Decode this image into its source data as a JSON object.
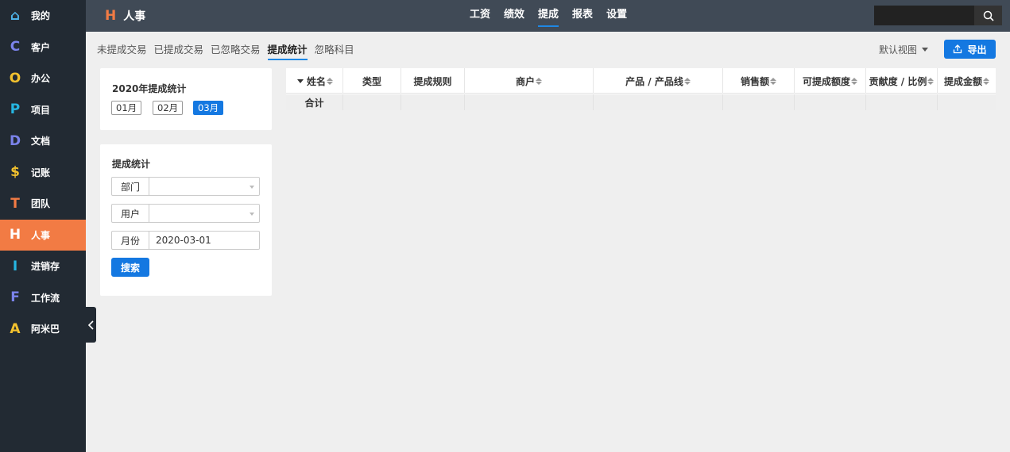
{
  "colors": {
    "sidebar_bg": "#222a33",
    "header_bg": "#404a56",
    "accent": "#f27b44",
    "primary": "#1478e1"
  },
  "sidebar": {
    "items": [
      {
        "letter": "⌂",
        "label": "我的",
        "color": "#4fb3e8",
        "icon": "home-icon"
      },
      {
        "letter": "C",
        "label": "客户",
        "color": "#7b83eb"
      },
      {
        "letter": "O",
        "label": "办公",
        "color": "#f2c12e"
      },
      {
        "letter": "P",
        "label": "项目",
        "color": "#26b6e2"
      },
      {
        "letter": "D",
        "label": "文档",
        "color": "#7b83eb"
      },
      {
        "letter": "$",
        "label": "记账",
        "color": "#f2c12e"
      },
      {
        "letter": "T",
        "label": "团队",
        "color": "#f27b44"
      },
      {
        "letter": "H",
        "label": "人事",
        "color": "#ffffff",
        "active": true
      },
      {
        "letter": "I",
        "label": "进销存",
        "color": "#26b6e2"
      },
      {
        "letter": "F",
        "label": "工作流",
        "color": "#7b83eb"
      },
      {
        "letter": "A",
        "label": "阿米巴",
        "color": "#f2c12e"
      }
    ]
  },
  "header": {
    "brand_letter": "H",
    "brand_title": "人事",
    "nav": [
      {
        "label": "工资"
      },
      {
        "label": "绩效"
      },
      {
        "label": "提成",
        "active": true
      },
      {
        "label": "报表"
      },
      {
        "label": "设置"
      }
    ],
    "search_value": ""
  },
  "tabs": {
    "items": [
      {
        "label": "未提成交易"
      },
      {
        "label": "已提成交易"
      },
      {
        "label": "已忽略交易"
      },
      {
        "label": "提成统计",
        "active": true
      },
      {
        "label": "忽略科目"
      }
    ],
    "view_label": "默认视图",
    "export_label": "导出"
  },
  "year_panel": {
    "title": "2020年提成统计",
    "months": [
      {
        "label": "01月"
      },
      {
        "label": "02月"
      },
      {
        "label": "03月",
        "active": true
      }
    ]
  },
  "filter_panel": {
    "title": "提成统计",
    "department_label": "部门",
    "department_value": "",
    "user_label": "用户",
    "user_value": "",
    "month_label": "月份",
    "month_value": "2020-03-01",
    "search_button": "搜索"
  },
  "table": {
    "columns": [
      {
        "label": "姓名",
        "sortable": true
      },
      {
        "label": "类型",
        "sortable": false
      },
      {
        "label": "提成规则",
        "sortable": false
      },
      {
        "label": "商户",
        "sortable": true
      },
      {
        "label": "产品 / 产品线",
        "sortable": true
      },
      {
        "label": "销售额",
        "sortable": true
      },
      {
        "label": "可提成额度",
        "sortable": true
      },
      {
        "label": "贡献度 / 比例",
        "sortable": true
      },
      {
        "label": "提成金额",
        "sortable": true
      }
    ],
    "total_label": "合计"
  }
}
